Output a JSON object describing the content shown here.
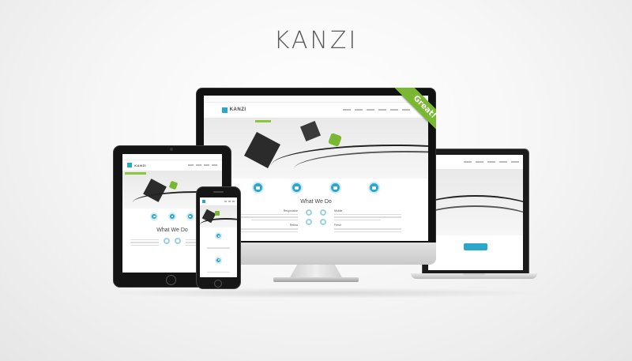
{
  "page": {
    "title": "KANZI"
  },
  "devices": {
    "monitor": {
      "ribbon_label": "Great!",
      "section_title": "What We Do",
      "features": [
        "Responsive",
        "Mobile",
        "Retina",
        "Fresh"
      ]
    },
    "tablet": {
      "section_title": "What We Do"
    },
    "phone": {}
  },
  "colors": {
    "accent": "#2aa7c9",
    "ribbon": "#7ab833",
    "banner_green": "#8cc63f"
  }
}
